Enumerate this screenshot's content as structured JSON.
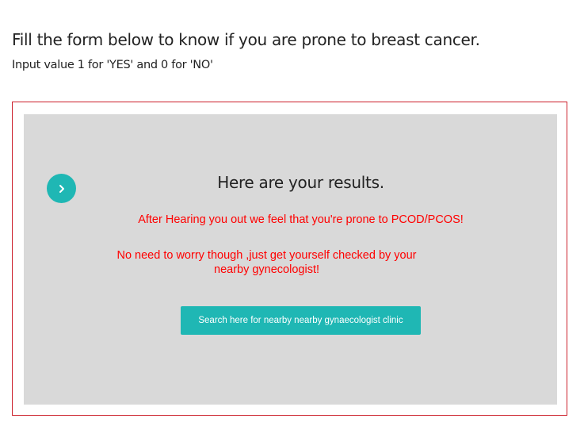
{
  "header": {
    "title": "Fill the form below to know if you are prone to breast cancer.",
    "subtitle": "Input value 1 for 'YES' and 0 for 'NO'"
  },
  "result": {
    "next_icon": "chevron-right-icon",
    "heading": "Here are your results.",
    "message_primary": "After Hearing you out we feel that you're prone to PCOD/PCOS!",
    "message_secondary": "No need to worry though ,just get yourself checked by your nearby gynecologist!",
    "search_button_label": "Search here for nearby nearby gynaecologist clinic"
  },
  "colors": {
    "accent": "#1fb7b4",
    "frame_border": "#cc1f2a",
    "panel_background": "#d9d9d9",
    "message_text": "#ff0000"
  }
}
